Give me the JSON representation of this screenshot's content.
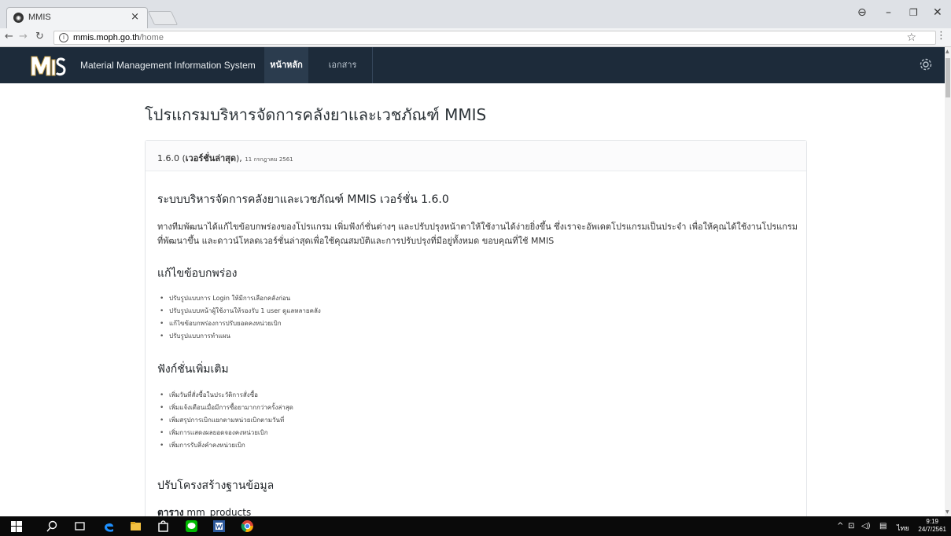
{
  "browser": {
    "tab_title": "MMIS",
    "tab_close": "×",
    "url_host": "mmis.moph.go.th",
    "url_path": "/home"
  },
  "navbar": {
    "brand": "Material Management Information System",
    "tab_home": "หน้าหลัก",
    "tab_docs": "เอกสาร"
  },
  "page": {
    "title": "โปรแกรมบริหารจัดการคลังยาและเวชภัณฑ์ MMIS"
  },
  "release": {
    "version": "1.6.0",
    "latest_label": "เวอร์ชั่นล่าสุด",
    "date": "11 กรกฎาคม 2561",
    "heading": "ระบบบริหารจัดการคลังยาและเวชภัณฑ์ MMIS เวอร์ชั่น 1.6.0",
    "intro": "ทางทีมพัฒนาได้แก้ไขข้อบกพร่องของโปรแกรม เพิ่มฟังก์ชั่นต่างๆ และปรับปรุงหน้าตาให้ใช้งานได้ง่ายยิ่งขึ้น ซึ่งเราจะอัพเดตโปรแกรมเป็นประจำ เพื่อให้คุณได้ใช้งานโปรแกรมที่พัฒนาขึ้น และดาวน์โหลดเวอร์ชั่นล่าสุดเพื่อใช้คุณสมบัติและการปรับปรุงที่มีอยู่ทั้งหมด ขอบคุณที่ใช้ MMIS",
    "fixes_heading": "แก้ไขข้อบกพร่อง",
    "fixes": [
      "ปรับรูปแบบการ Login ให้มีการเลือกคลังก่อน",
      "ปรับรูปแบบหน้าผู้ใช้งานให้รองรับ 1 user ดูแลหลายคลัง",
      "แก้ไขข้อบกพร่องการปรับยอดคงหน่วยเบิก",
      "ปรับรูปแบบการทำแผน"
    ],
    "features_heading": "ฟังก์ชั่นเพิ่มเติม",
    "features": [
      "เพิ่มวันที่สั่งซื้อในประวัติการสั่งซื้อ",
      "เพิ่มแจ้งเตือนเมื่อมีการซื้อยามากกว่าครั้งล่าสุด",
      "เพิ่มสรุปการเบิกแยกตามหน่วยเบิกตามวันที่",
      "เพิ่มการแสดงผลยอดจองคงหน่วยเบิก",
      "เพิ่มการรับสิ่งคำคงหน่วยเบิก"
    ],
    "structure_heading": "ปรับโครงสร้างฐานข้อมูล",
    "table_prefix": "ตาราง",
    "table_name": "mm_products"
  },
  "taskbar": {
    "lang": "ไทย",
    "time": "9:19",
    "date": "24/7/2561"
  },
  "colors": {
    "navbar_bg": "#1d2b3a",
    "navbar_active": "#2b3c4e",
    "taskbar_bg": "#0a0a0a"
  }
}
